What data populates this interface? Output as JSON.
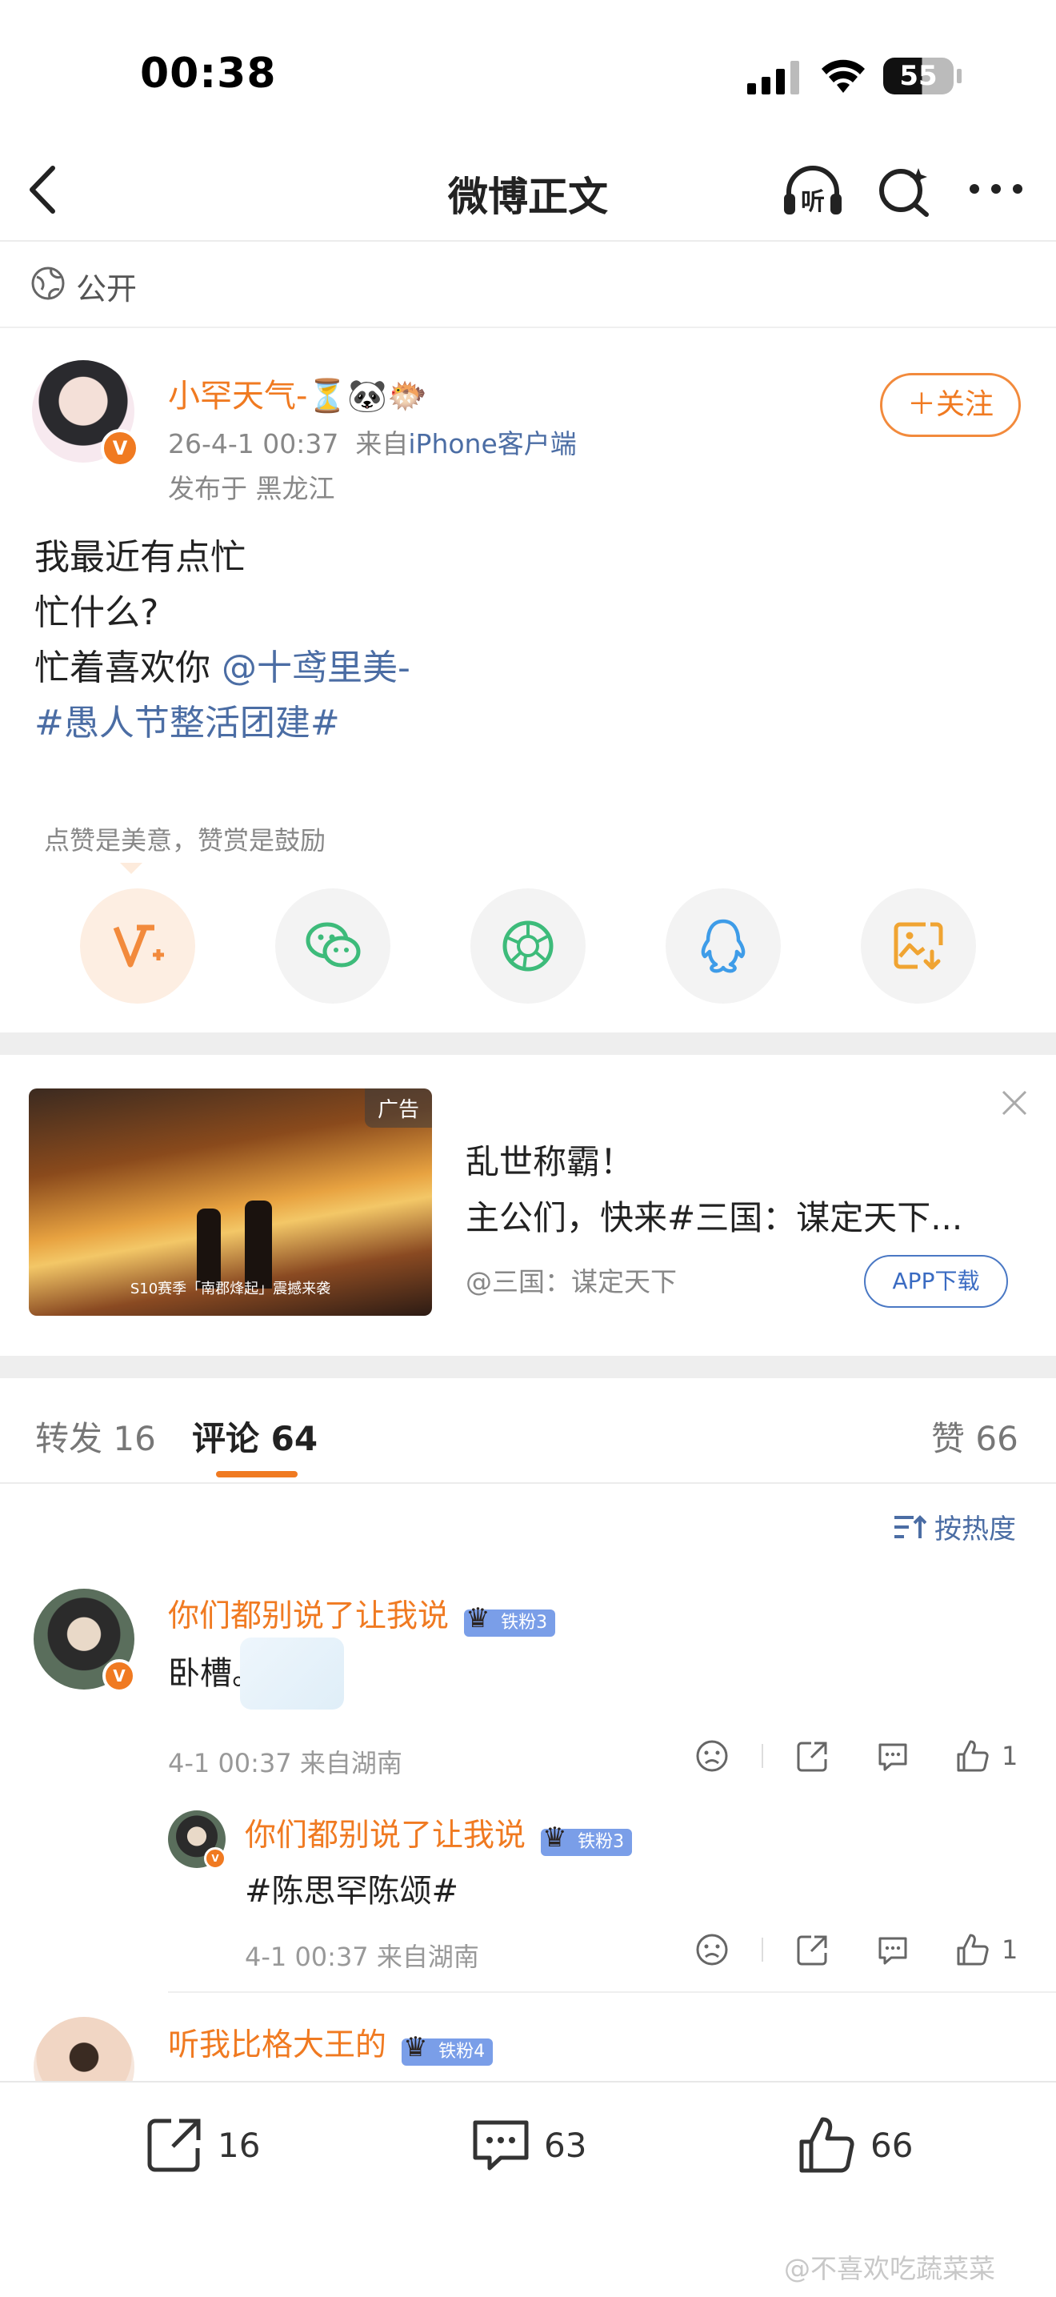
{
  "status_bar": {
    "time": "00:38",
    "battery": "55"
  },
  "nav": {
    "title": "微博正文"
  },
  "visibility": {
    "label": "公开"
  },
  "post": {
    "author": "小罕天气-⏳🐼🐡",
    "time": "26-4-1 00:37",
    "source_prefix": "来自",
    "source": "iPhone客户端",
    "location": "发布于 黑龙江",
    "follow_label": "＋关注",
    "lines": [
      "我最近有点忙",
      "忙什么?",
      "忙着喜欢你 "
    ],
    "mention": "@十鸢里美-",
    "topic": "#愚人节整活团建#"
  },
  "reward": {
    "tip": "点赞是美意，赞赏是鼓励"
  },
  "ad": {
    "tag": "广告",
    "caption": "S10赛季「南郡烽起」震撼来袭",
    "title": "乱世称霸！",
    "text": "主公们，快来#三国：谋定天下...",
    "account": "@三国：谋定天下",
    "button": "APP下载"
  },
  "tabs": {
    "repost": "转发 16",
    "comment": "评论 64",
    "like": "赞 66"
  },
  "sort": {
    "label": "按热度"
  },
  "comments": [
    {
      "name": "你们都别说了让我说",
      "badge": "铁粉3",
      "text": "卧槽。",
      "meta": "4-1 00:37  来自湖南",
      "likes": "1",
      "reply": {
        "name": "你们都别说了让我说",
        "badge": "铁粉3",
        "text": "#陈思罕陈颂#",
        "meta": "4-1 00:37  来自湖南",
        "likes": "1"
      }
    },
    {
      "name": "听我比格大王的",
      "badge": "铁粉4"
    }
  ],
  "bottom_bar": {
    "reposts": "16",
    "comments": "63",
    "likes": "66"
  },
  "watermark": "@不喜欢吃蔬菜菜"
}
